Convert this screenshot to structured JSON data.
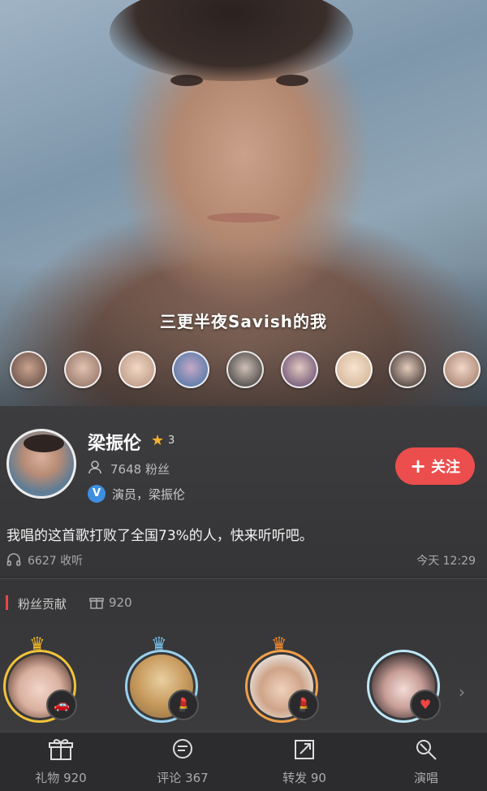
{
  "cover": {
    "caption": "三更半夜Savish的我",
    "listeners": [
      {
        "color": "#c9a28d"
      },
      {
        "color": "#8a6a5d"
      },
      {
        "color": "#d8b79f"
      },
      {
        "color": "#6d9ec8"
      },
      {
        "color": "#4a4a4a"
      },
      {
        "color": "#7a5a8a"
      },
      {
        "color": "#e5cbb0"
      },
      {
        "color": "#3b2f2e"
      },
      {
        "color": "#d6b3a1"
      }
    ]
  },
  "profile": {
    "username": "梁振伦",
    "level": "3",
    "fans": "7648 粉丝",
    "verified_label": "V",
    "verified_text": "演员，梁振伦",
    "follow_label": "关注",
    "follow_icon": "plus-icon"
  },
  "post": {
    "description": "我唱的这首歌打败了全国73%的人，快来听听吧。",
    "plays": "6627 收听",
    "time": "今天 12:29"
  },
  "contribution": {
    "title": "粉丝贡献",
    "count": "920"
  },
  "tabbar": {
    "tabs": [
      {
        "label": "礼物 920",
        "icon": "gift-icon"
      },
      {
        "label": "评论 367",
        "icon": "comment-icon"
      },
      {
        "label": "转发 90",
        "icon": "share-icon"
      },
      {
        "label": "演唱",
        "icon": "sing-icon"
      }
    ]
  }
}
